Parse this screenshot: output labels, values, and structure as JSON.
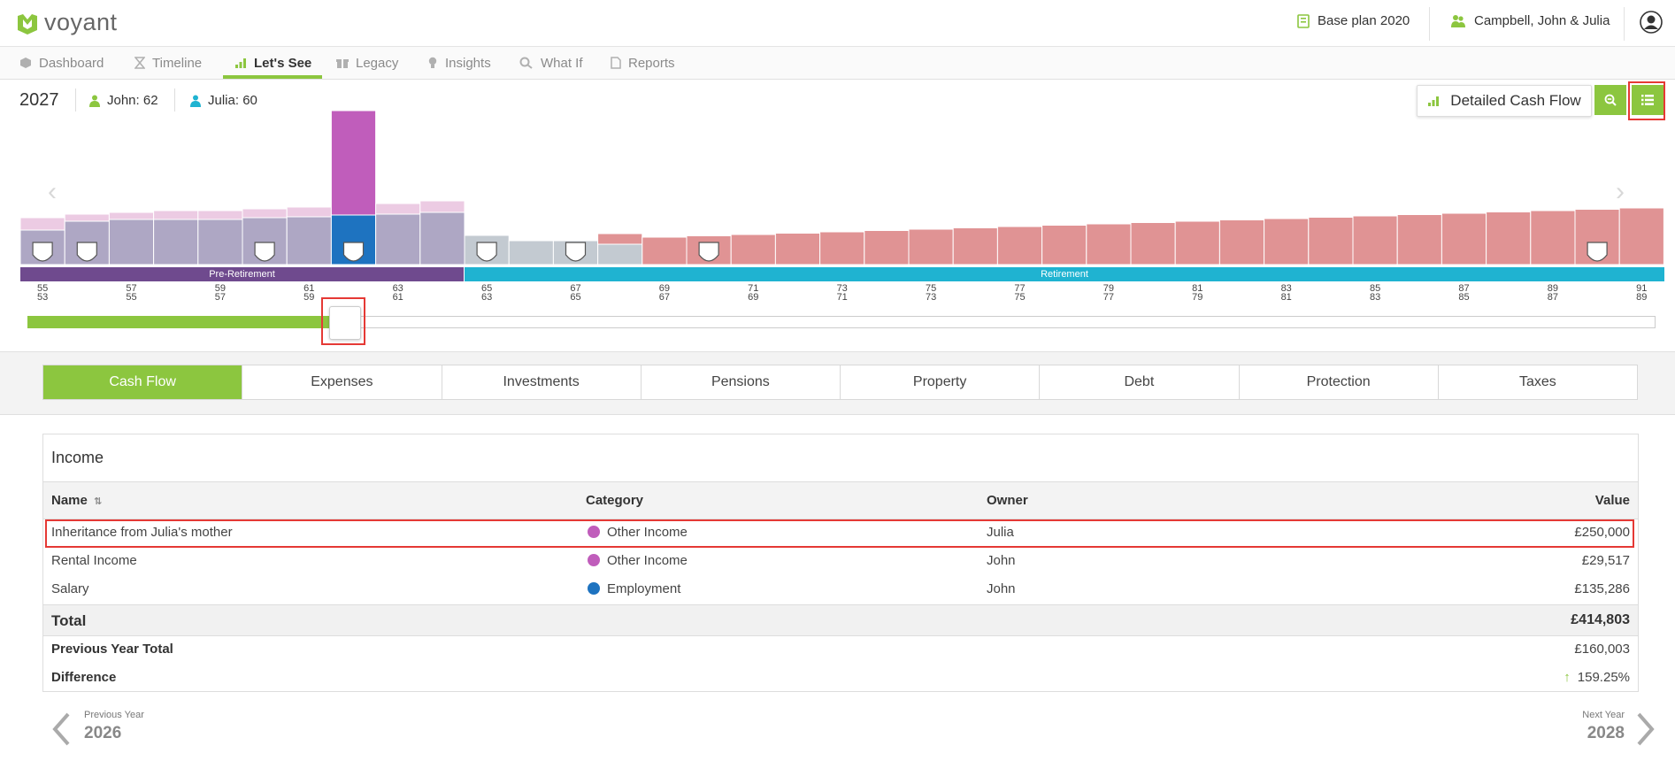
{
  "header": {
    "brand": "voyant",
    "plan_label": "Base plan 2020",
    "client_label": "Campbell, John & Julia"
  },
  "nav": {
    "tabs": [
      {
        "label": "Dashboard"
      },
      {
        "label": "Timeline"
      },
      {
        "label": "Let's See"
      },
      {
        "label": "Legacy"
      },
      {
        "label": "Insights"
      },
      {
        "label": "What If"
      },
      {
        "label": "Reports"
      }
    ],
    "active_index": 2
  },
  "info": {
    "year": "2027",
    "person1_label": "John: ",
    "person1_age": "62",
    "person2_label": "Julia: ",
    "person2_age": "60",
    "detailed_btn_label": "Detailed Cash Flow"
  },
  "chart_data": {
    "type": "bar",
    "phases": [
      "Pre-Retirement",
      "Retirement"
    ],
    "age_labels_john": [
      "55",
      "57",
      "59",
      "61",
      "63",
      "65",
      "67",
      "69",
      "71",
      "73",
      "75",
      "77",
      "79",
      "81",
      "83",
      "85",
      "87",
      "89",
      "91"
    ],
    "age_labels_julia": [
      "53",
      "55",
      "57",
      "59",
      "61",
      "63",
      "65",
      "67",
      "69",
      "71",
      "73",
      "75",
      "77",
      "79",
      "81",
      "83",
      "85",
      "87",
      "89"
    ],
    "selected_year": 2027,
    "colors": {
      "income": "#aea7c4",
      "surplus": "#eccbe3",
      "inheritance": "#c05dbb",
      "employment": "#1e73c0",
      "shortfall": "#e09394",
      "grey": "#c3cad1",
      "pre_retirement": "#6f4a8e",
      "retirement": "#1fb3d1"
    }
  },
  "slider": {
    "progress": 0.19
  },
  "category_tabs": {
    "items": [
      "Cash Flow",
      "Expenses",
      "Investments",
      "Pensions",
      "Property",
      "Debt",
      "Protection",
      "Taxes"
    ],
    "active_index": 0
  },
  "income_table": {
    "title": "Income",
    "columns": {
      "name": "Name",
      "category": "Category",
      "owner": "Owner",
      "value": "Value"
    },
    "rows": [
      {
        "name": "Inheritance from Julia's mother",
        "category": "Other Income",
        "category_color": "#c05dbb",
        "owner": "Julia",
        "value": "£250,000"
      },
      {
        "name": "Rental Income",
        "category": "Other Income",
        "category_color": "#c05dbb",
        "owner": "John",
        "value": "£29,517"
      },
      {
        "name": "Salary",
        "category": "Employment",
        "category_color": "#1e73c0",
        "owner": "John",
        "value": "£135,286"
      }
    ],
    "total_label": "Total",
    "total_value": "£414,803",
    "prev_total_label": "Previous Year Total",
    "prev_total_value": "£160,003",
    "difference_label": "Difference",
    "difference_value": "159.25%"
  },
  "footer": {
    "prev_label": "Previous Year",
    "prev_year": "2026",
    "next_label": "Next Year",
    "next_year": "2028"
  }
}
